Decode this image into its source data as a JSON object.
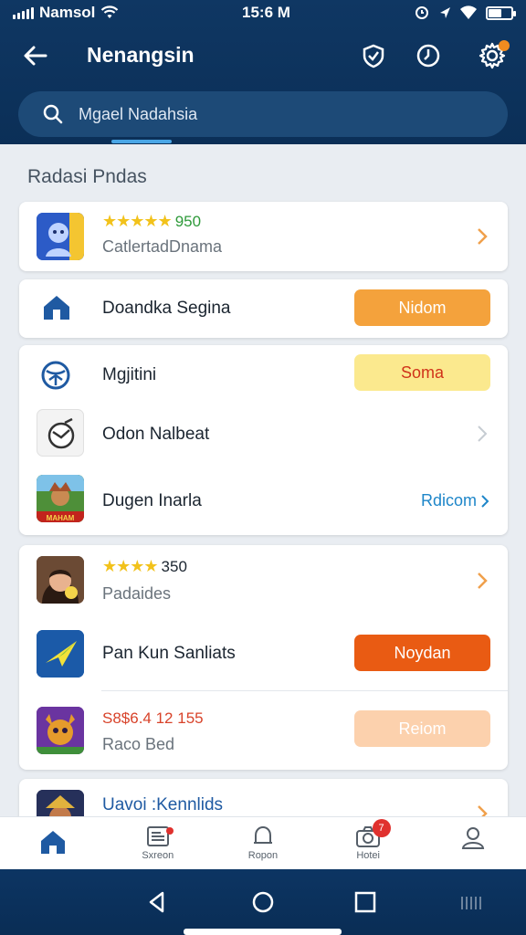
{
  "status_bar": {
    "carrier": "Namsol",
    "time": "15:6 M"
  },
  "header": {
    "title": "Nenangsin"
  },
  "search": {
    "placeholder": "Mgael Nadahsia"
  },
  "section": {
    "title": "Radasi Pndas"
  },
  "items": [
    {
      "rating_text": "950",
      "stars": 5,
      "subtitle": "CatlertadDnama"
    },
    {
      "name": "Doandka Segina",
      "button": "Nidom",
      "button_color": "#f4a23c"
    },
    {
      "name": "Mgjitini",
      "button": "Soma",
      "button_color": "#fbe98e"
    },
    {
      "name": "Odon Nalbeat"
    },
    {
      "name": "Dugen Inarla",
      "link": "Rdicom",
      "icon_text": "MAHAM"
    },
    {
      "rating_text": "350",
      "stars": 4,
      "subtitle": "Padaides"
    },
    {
      "name": "Pan Kun Sanliats",
      "button": "Noydan",
      "button_color": "#e95b13"
    },
    {
      "price_text": "S8$6.4 12 155",
      "subtitle": "Raco Bed",
      "button": "Reiom",
      "button_color": "#fcd1ad"
    },
    {
      "name": "Uavoi :Kennlids"
    }
  ],
  "bottom_nav": [
    {
      "label": "",
      "icon": "home-icon"
    },
    {
      "label": "Sxreon",
      "icon": "news-icon"
    },
    {
      "label": "Ropon",
      "icon": "bell-icon"
    },
    {
      "label": "Hotei",
      "icon": "camera-icon",
      "badge": "7"
    },
    {
      "label": "",
      "icon": "profile-icon"
    }
  ],
  "colors": {
    "header_bg": "#0f3763",
    "accent": "#1e86c9",
    "page_bg": "#e9edf2"
  }
}
